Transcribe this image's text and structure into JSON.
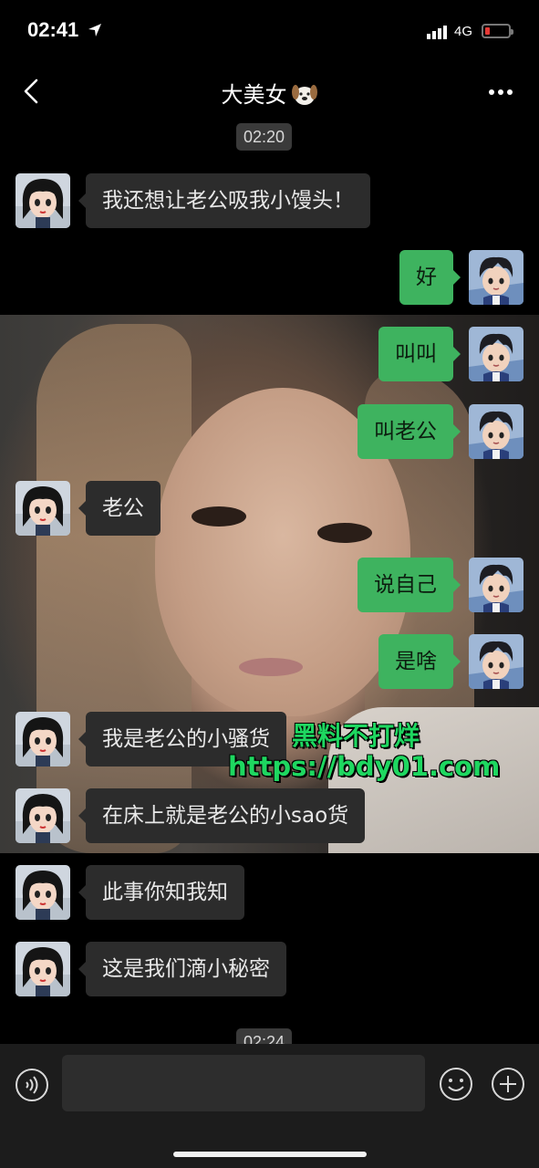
{
  "status_bar": {
    "time": "02:41",
    "network": "4G",
    "location_icon": "location-arrow-icon",
    "battery_color": "#e53935"
  },
  "header": {
    "title": "大美女",
    "title_emoji": "dog-emoji-icon",
    "back_icon": "chevron-left-icon",
    "more_icon": "more-dots-icon"
  },
  "chat": {
    "timestamp_top": "02:20",
    "timestamp_bottom": "02:24",
    "messages": [
      {
        "side": "in",
        "text": "我还想让老公吸我小馒头！"
      },
      {
        "side": "out",
        "text": "好"
      },
      {
        "side": "out",
        "text": "叫叫"
      },
      {
        "side": "out",
        "text": "叫老公"
      },
      {
        "side": "in",
        "text": "老公"
      },
      {
        "side": "out",
        "text": "说自己"
      },
      {
        "side": "out",
        "text": "是啥"
      },
      {
        "side": "in",
        "text": "我是老公的小骚货"
      },
      {
        "side": "in",
        "text": "在床上就是老公的小sao货"
      },
      {
        "side": "in",
        "text": "此事你知我知"
      },
      {
        "side": "in",
        "text": "这是我们滴小秘密"
      }
    ],
    "bubble_colors": {
      "outgoing": "#3eb35f",
      "incoming": "#2c2c2c"
    }
  },
  "watermark": {
    "line1": "黑料不打烊",
    "line2": "https://bdy01.com",
    "color": "#1ed760"
  },
  "input_bar": {
    "voice_icon": "voice-icon",
    "emoji_icon": "emoji-smile-icon",
    "plus_icon": "plus-circle-icon",
    "placeholder": ""
  }
}
